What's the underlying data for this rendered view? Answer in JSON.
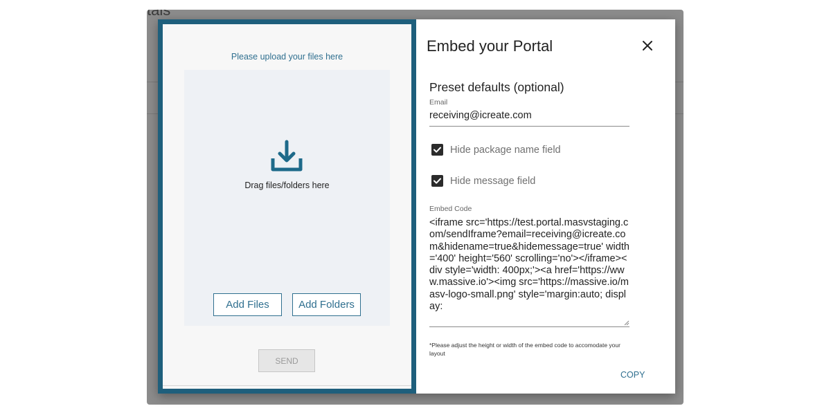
{
  "backdrop": {
    "title_fragment": "tals"
  },
  "preview": {
    "title": "Please upload your files here",
    "drop_text": "Drag files/folders here",
    "add_files_label": "Add Files",
    "add_folders_label": "Add Folders",
    "send_label": "SEND"
  },
  "dialog": {
    "title": "Embed your Portal",
    "section_title": "Preset defaults (optional)",
    "email_label": "Email",
    "email_value": "receiving@icreate.com",
    "options": [
      {
        "label": "Hide package name field",
        "checked": true
      },
      {
        "label": "Hide message field",
        "checked": true
      }
    ],
    "embed_label": "Embed Code",
    "embed_code": "<iframe src='https://test.portal.masvstaging.com/sendIframe?email=receiving@icreate.com&hidename=true&hidemessage=true' width='400' height='560' scrolling='no'></iframe><div style='width: 400px;'><a href='https://www.massive.io'><img src='https://massive.io/masv-logo-small.png' style='margin:auto; display:",
    "note": "*Please adjust the height or width of the embed code to accomodate your layout",
    "copy_label": "COPY"
  },
  "colors": {
    "accent": "#2f6f8f",
    "frame": "#1e5f7c",
    "backdrop": "#8c8c8c"
  },
  "icons": [
    "upload-icon",
    "close-icon",
    "check-icon"
  ]
}
